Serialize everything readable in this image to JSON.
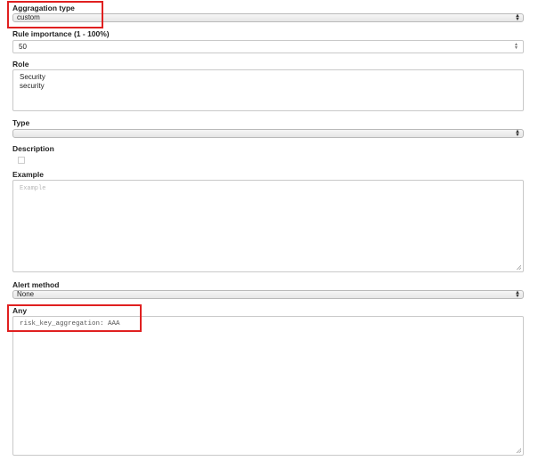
{
  "aggregation_type": {
    "label": "Aggragation type",
    "value": "custom"
  },
  "rule_importance": {
    "label": "Rule importance (1 - 100%)",
    "value": "50"
  },
  "role": {
    "label": "Role",
    "lines": [
      "Security",
      "security"
    ]
  },
  "type": {
    "label": "Type",
    "value": ""
  },
  "description": {
    "label": "Description"
  },
  "example": {
    "label": "Example",
    "placeholder": "Example"
  },
  "alert_method": {
    "label": "Alert method",
    "value": "None"
  },
  "any": {
    "label": "Any",
    "value": "risk_key_aggregation: AAA"
  },
  "colors": {
    "highlight": "#e02020"
  }
}
